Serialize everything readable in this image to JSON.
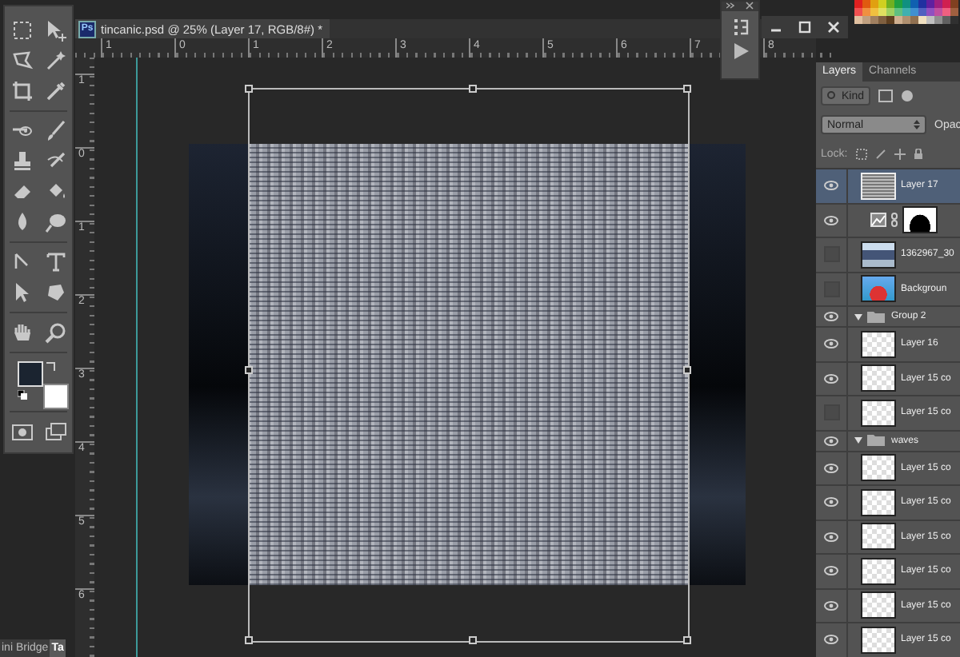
{
  "document": {
    "app_badge": "Ps",
    "title": "tincanic.psd @ 25% (Layer 17, RGB/8#) *",
    "ruler_h": [
      "1",
      "0",
      "1",
      "2",
      "3",
      "4",
      "5",
      "6",
      "7",
      "8"
    ],
    "ruler_v": [
      "1",
      "0",
      "1",
      "2",
      "3",
      "4",
      "5",
      "6"
    ]
  },
  "bottom_tabs": [
    {
      "label": "ini Bridge",
      "selected": false
    },
    {
      "label": "Ta",
      "selected": true
    }
  ],
  "layers": {
    "tabs": [
      {
        "label": "Layers",
        "selected": true
      },
      {
        "label": "Channels",
        "selected": false
      }
    ],
    "filter": "Kind",
    "blend_mode": "Normal",
    "opacity_label": "Opac",
    "lock_label": "Lock:",
    "rows": [
      {
        "kind": "noise",
        "name": "Layer 17",
        "visible": true,
        "selected": true
      },
      {
        "kind": "adjustment",
        "visible": true,
        "selected": false
      },
      {
        "kind": "photo",
        "name": "1362967_30",
        "visible": false,
        "selected": false
      },
      {
        "kind": "boat",
        "name": "Backgroun",
        "visible": false,
        "selected": false
      },
      {
        "kind": "group",
        "name": "Group 2",
        "visible": true,
        "selected": false,
        "expanded": true,
        "children": [
          {
            "kind": "layer",
            "name": "Layer 16",
            "visible": true,
            "selected": false
          },
          {
            "kind": "layer",
            "name": "Layer 15 co",
            "visible": true,
            "selected": false
          },
          {
            "kind": "layer",
            "name": "Layer 15 co",
            "visible": false,
            "selected": false
          }
        ]
      },
      {
        "kind": "group",
        "name": "waves",
        "visible": true,
        "selected": false,
        "expanded": true,
        "children": [
          {
            "kind": "layer",
            "name": "Layer 15 co",
            "visible": true,
            "selected": false
          },
          {
            "kind": "layer",
            "name": "Layer 15 co",
            "visible": true,
            "selected": false
          },
          {
            "kind": "layer",
            "name": "Layer 15 co",
            "visible": true,
            "selected": false
          },
          {
            "kind": "layer",
            "name": "Layer 15 co",
            "visible": true,
            "selected": false
          },
          {
            "kind": "layer",
            "name": "Layer 15 co",
            "visible": true,
            "selected": false
          },
          {
            "kind": "layer",
            "name": "Layer 15 co",
            "visible": true,
            "selected": false
          }
        ]
      }
    ]
  }
}
